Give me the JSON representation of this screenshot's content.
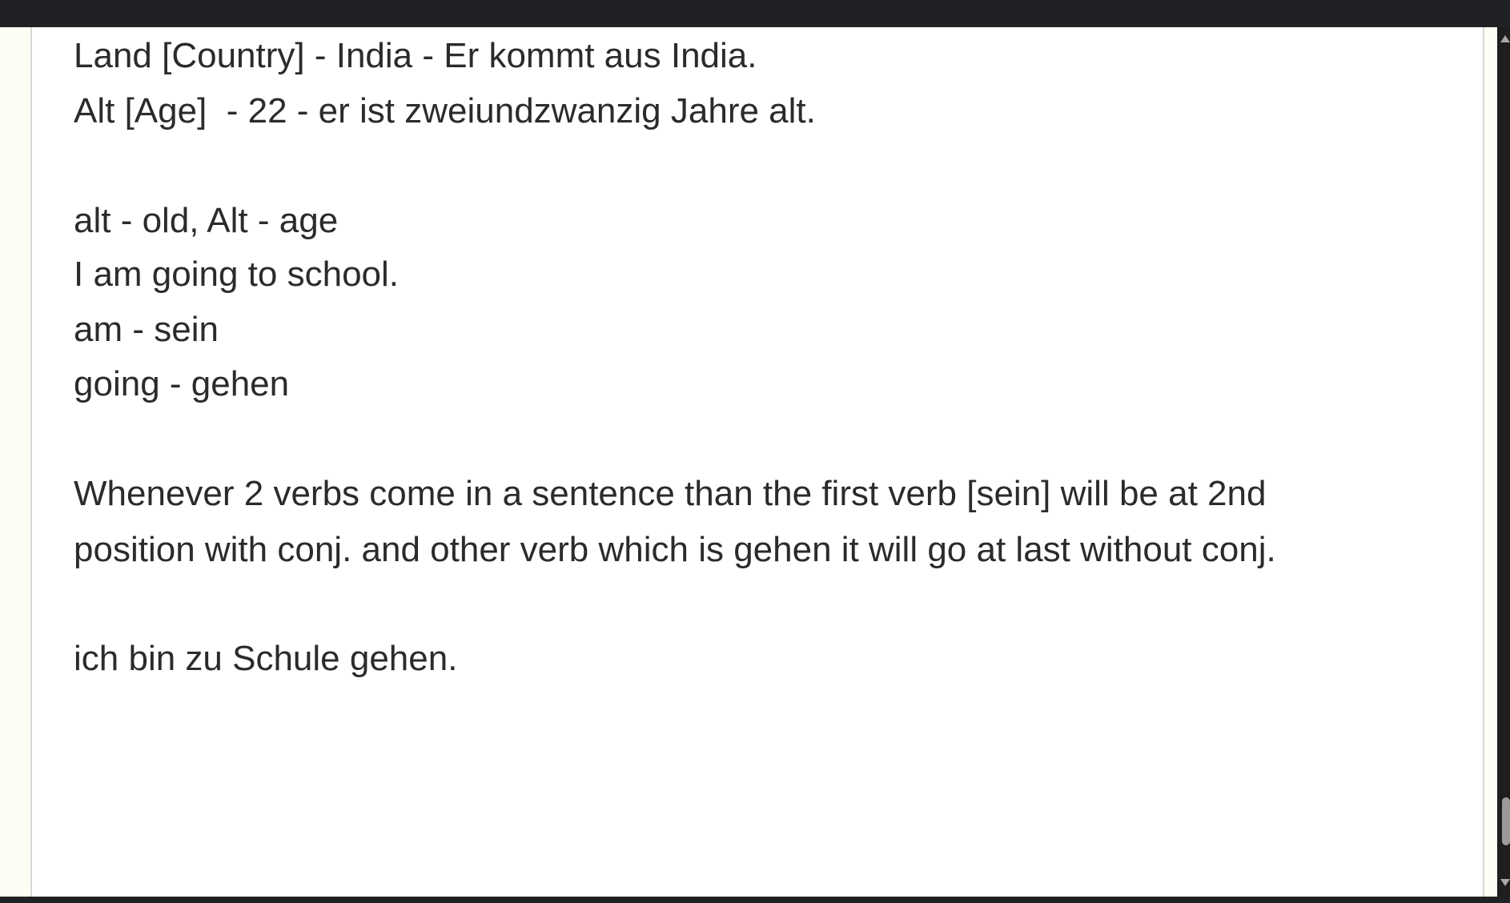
{
  "document": {
    "lines": [
      "Land [Country] - India - Er kommt aus India.",
      "Alt [Age]  - 22 - er ist zweiundzwanzig Jahre alt.",
      "alt - old, Alt - age",
      "I am going to school.",
      "am - sein",
      "going - gehen",
      "Whenever 2 verbs come in a sentence than the first verb [sein] will be at 2nd",
      "position with conj. and other verb which is gehen it will go at last without conj.",
      "ich bin zu Schule gehen."
    ]
  }
}
